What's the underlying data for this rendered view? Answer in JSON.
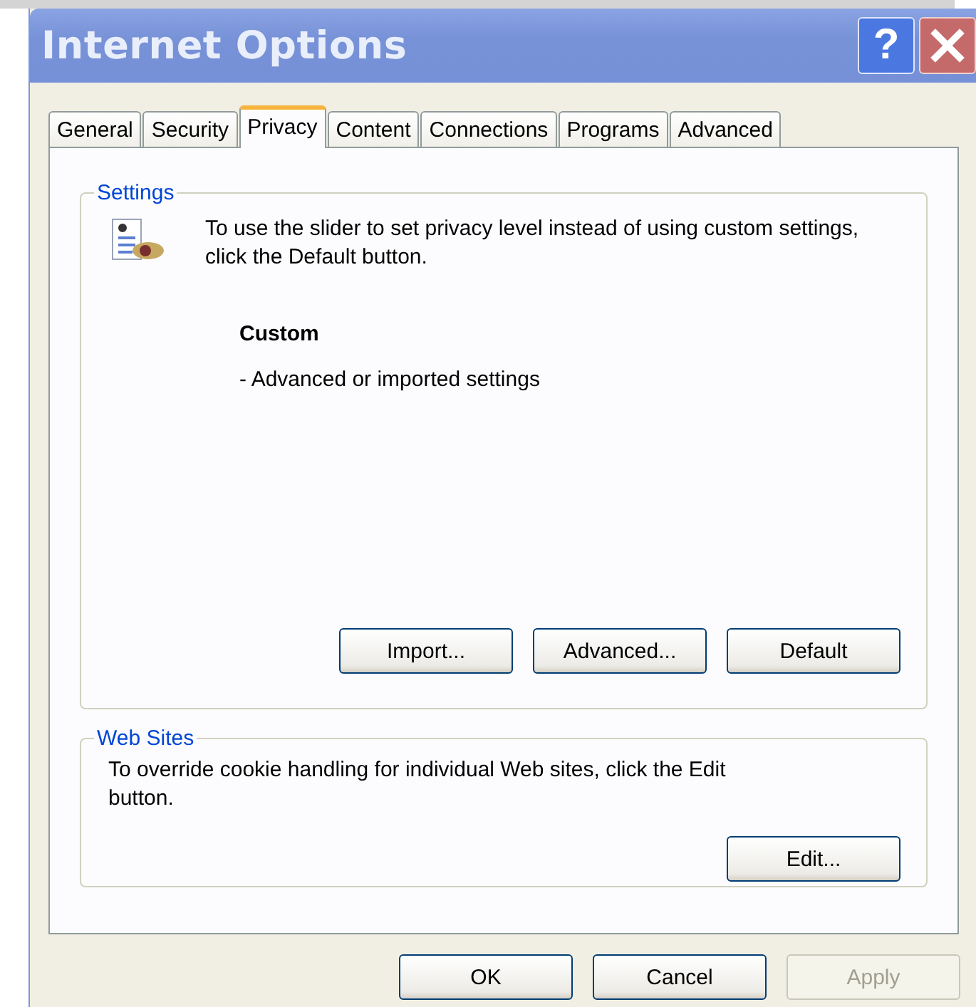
{
  "window": {
    "title": "Internet Options",
    "help_button": "?"
  },
  "tabs": [
    {
      "label": "General",
      "selected": false
    },
    {
      "label": "Security",
      "selected": false
    },
    {
      "label": "Privacy",
      "selected": true
    },
    {
      "label": "Content",
      "selected": false
    },
    {
      "label": "Connections",
      "selected": false
    },
    {
      "label": "Programs",
      "selected": false
    },
    {
      "label": "Advanced",
      "selected": false
    }
  ],
  "settings": {
    "legend": "Settings",
    "description": "To use the slider to set privacy level instead of using custom settings, click the Default button.",
    "level_name": "Custom",
    "level_description": "- Advanced or imported settings",
    "buttons": [
      {
        "label": "Import...",
        "disabled": false
      },
      {
        "label": "Advanced...",
        "disabled": false
      },
      {
        "label": "Default",
        "disabled": false
      }
    ]
  },
  "web_sites": {
    "legend": "Web Sites",
    "description": "To override cookie handling for individual Web sites, click the Edit button.",
    "buttons": [
      {
        "label": "Edit...",
        "disabled": false
      }
    ]
  },
  "dialog_buttons": [
    {
      "label": "OK",
      "disabled": false
    },
    {
      "label": "Cancel",
      "disabled": false
    },
    {
      "label": "Apply",
      "disabled": true
    }
  ]
}
